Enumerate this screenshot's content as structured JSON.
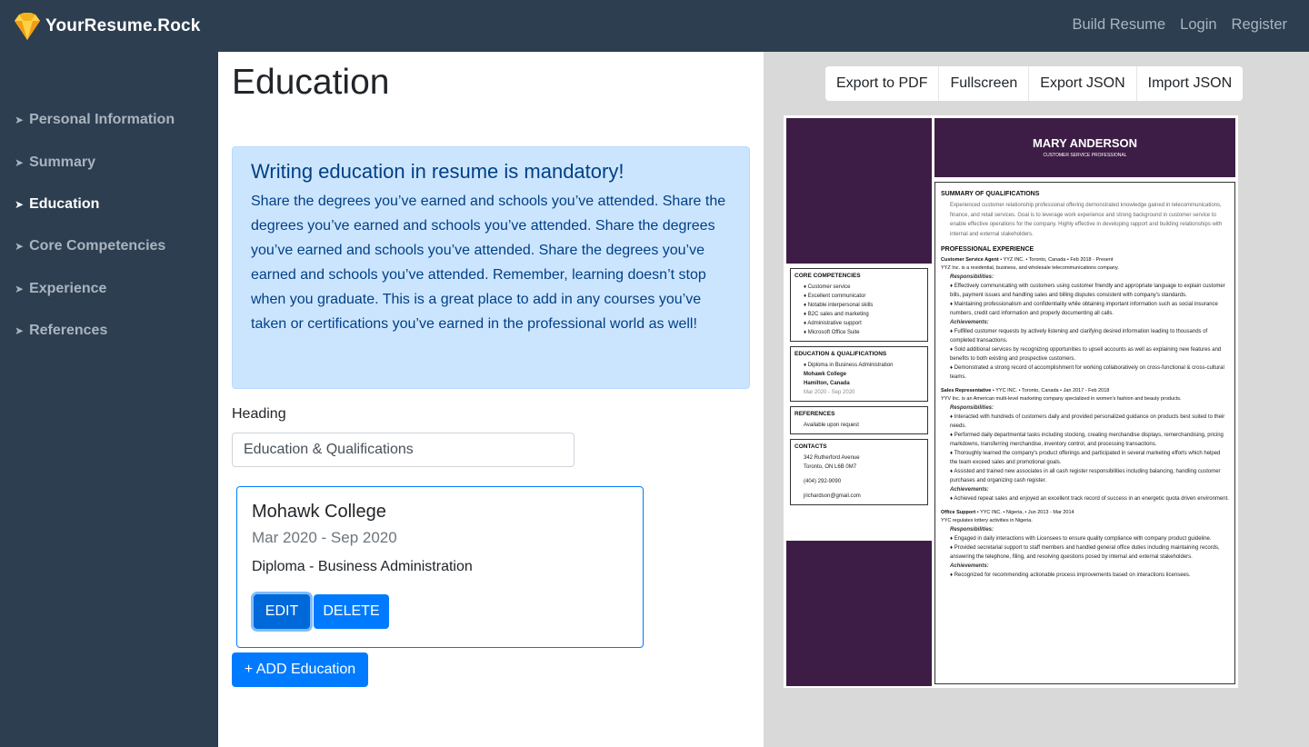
{
  "brand": {
    "name": "YourResume.Rock"
  },
  "nav": {
    "build": "Build Resume",
    "login": "Login",
    "register": "Register"
  },
  "sidebar": {
    "items": [
      {
        "label": "Personal Information"
      },
      {
        "label": "Summary"
      },
      {
        "label": "Education"
      },
      {
        "label": "Core Competencies"
      },
      {
        "label": "Experience"
      },
      {
        "label": "References"
      }
    ],
    "active": "Education"
  },
  "main": {
    "title": "Education",
    "alert": {
      "heading": "Writing education in resume is mandatory!",
      "body": "Share the degrees you’ve earned and schools you’ve attended. Share the degrees you’ve earned and schools you’ve attended. Share the degrees you’ve earned and schools you’ve attended. Share the degrees you’ve earned and schools you’ve attended. Remember, learning doesn’t stop when you graduate. This is a great place to add in any courses you’ve taken or certifications you’ve earned in the professional world as well!"
    },
    "heading_label": "Heading",
    "heading_value": "Education & Qualifications",
    "card": {
      "school": "Mohawk College",
      "dates": "Mar 2020 - Sep 2020",
      "degree": "Diploma - Business Administration",
      "edit": "EDIT",
      "delete": "DELETE"
    },
    "add_button": "+ ADD Education"
  },
  "toolbar": {
    "pdf": "Export to PDF",
    "fullscreen": "Fullscreen",
    "export_json": "Export JSON",
    "import_json": "Import JSON"
  },
  "resume": {
    "name": "MARY ANDERSON",
    "title": "CUSTOMER SERVICE PROFESSIONAL",
    "core_heading": "CORE COMPETENCIES",
    "core": [
      "♦ Customer service",
      "♦ Excellent communicator",
      "♦ Notable interpersonal skills",
      "♦ B2C sales and marketing",
      "♦ Administrative support",
      "♦ Microsoft Office Suite"
    ],
    "edu_heading": "EDUCATION & QUALIFICATIONS",
    "edu_degree": "♦ Diploma in Business Administration",
    "edu_school": "Mohawk College",
    "edu_city": "Hamilton, Canada",
    "edu_dates": "Mar 2020 - Sep 2020",
    "ref_heading": "REFERENCES",
    "ref_text": "Available upon request",
    "contacts_heading": "CONTACTS",
    "contact_address1": "342 Rutherford Avenue",
    "contact_address2": "Toronto, ON L6B 0M7",
    "contact_phone": "(404) 292-9090",
    "contact_email": "jrichardson@gmail.com",
    "summary_heading": "SUMMARY OF QUALIFICATIONS",
    "summary_text": "Experienced customer relationship professional offering demonstrated knowledge gained in telecommunications, finance, and retail services. Goal is to leverage work experience and strong background in customer service to enable effective operations for the company. Highly effective in developing rapport and building relationships with internal and external stakeholders.",
    "exp_heading": "PROFESSIONAL EXPERIENCE",
    "jobs": [
      {
        "title": "Customer Service Agent",
        "meta": " • YYZ INC. •  Toronto, Canada • Feb 2018 - Present",
        "desc": "YYZ Inc. is a residential, business, and wholesale telecommunications company.",
        "resp": [
          "♦ Effectively communicating with customers using customer friendly and appropriate language to explain customer bills, payment issues and handling sales and billing disputes consistent with company's standards.",
          "♦ Maintaining professionalism and confidentiality while obtaining important information such as social insurance numbers, credit card information and properly documenting all calls."
        ],
        "ach": [
          "♦ Fulfilled customer requests by actively listening and clarifying desired information leading to thousands of completed transactions.",
          "♦ Sold additional services by recognizing opportunities to upsell accounts as well as explaining new features and benefits to both existing and prospective customers.",
          "♦ Demonstrated a strong record of accomplishment for working collaboratively on cross-functional & cross-cultural teams."
        ]
      },
      {
        "title": "Sales Representative",
        "meta": " • YYC INC. •  Toronto, Canada • Jan 2017 - Feb 2018",
        "desc": "YYV Inc. is an American multi-level marketing company specialized in women's fashion and beauty products.",
        "resp": [
          "♦ Interacted with hundreds of customers daily and provided personalized guidance on products best suited to their needs.",
          "♦ Performed daily departmental tasks including stocking, creating merchandise displays, remerchandising, pricing markdowns, transferring merchandise, inventory control, and processing transactions.",
          "♦ Thoroughly learned the company's product offerings and participated in several marketing efforts which helped the team exceed sales and promotional goals.",
          "♦ Assisted and trained new associates in all cash register responsibilities including balancing, handling customer purchases and organizing cash register."
        ],
        "ach": [
          "♦ Achieved repeat sales and enjoyed an excellent track record of success in an energetic quota driven environment."
        ]
      },
      {
        "title": "Office Support",
        "meta": " • YYC INC. •  Nigeria,  • Jun 2013 - Mar 2014",
        "desc": "YYC regulates lottery activities in Nigeria.",
        "resp": [
          "♦ Engaged in daily interactions with Licensees to ensure quality compliance with company product guideline.",
          "♦ Provided secretarial support to staff members and handled general office duties including maintaining records, answering the telephone, filing, and resolving questions posed by internal and external stakeholders."
        ],
        "ach": [
          "♦ Recognized for recommending actionable process improvements based on interactions licensees."
        ]
      }
    ],
    "resp_label": "Responsibilities:",
    "ach_label": "Achievements:"
  }
}
